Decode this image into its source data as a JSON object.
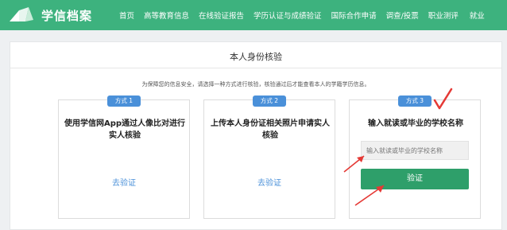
{
  "header": {
    "brand": "学信档案",
    "nav": [
      "首页",
      "高等教育信息",
      "在线验证报告",
      "学历认证与成绩验证",
      "国际合作申请",
      "调查/投票",
      "职业测评",
      "就业"
    ]
  },
  "panel": {
    "title": "本人身份核验",
    "notice": "为保障您的信息安全，请选择一种方式进行核验，核验通过后才能查看本人的学籍学历信息。"
  },
  "cards": [
    {
      "badge": "方式 1",
      "text": "使用学信网App通过人像比对进行实人核验",
      "link": "去验证"
    },
    {
      "badge": "方式 2",
      "text": "上传本人身份证相关照片申请实人核验",
      "link": "去验证"
    },
    {
      "badge": "方式 3",
      "text": "输入就读或毕业的学校名称",
      "input_placeholder": "输入就读或毕业的学校名称",
      "button": "验证"
    }
  ],
  "colors": {
    "header": "#3db27e",
    "badge": "#4a90d9",
    "button": "#2e9f6a",
    "annotation": "#e53935"
  }
}
